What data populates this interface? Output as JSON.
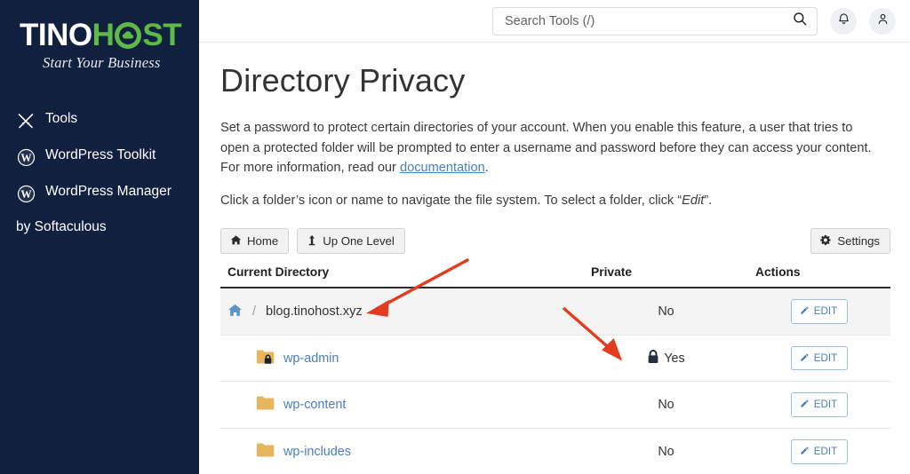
{
  "brand": {
    "logo_tino": "TINO",
    "logo_h": "H",
    "logo_s": "S",
    "logo_t": "T",
    "tagline": "Start Your Business",
    "accent_green": "#5bbb46",
    "sidebar_bg": "#122040"
  },
  "sidebar": {
    "items": [
      {
        "label": "Tools",
        "icon": "tools-icon"
      },
      {
        "label": "WordPress Toolkit",
        "icon": "wordpress-icon"
      },
      {
        "label": "WordPress Manager",
        "label2": "by Softaculous",
        "icon": "wordpress-icon"
      }
    ]
  },
  "topbar": {
    "search_placeholder": "Search Tools (/)",
    "search_value": "",
    "search_icon": "search-icon",
    "bell_icon": "bell-icon",
    "account_icon": "user-icon"
  },
  "page": {
    "title": "Directory Privacy",
    "desc_part1": "Set a password to protect certain directories of your account. When you enable this feature, a user that tries to open a protected folder will be prompted to enter a username and password before they can access your content. For more information, read our ",
    "desc_link": "documentation",
    "desc_part2": ".",
    "desc2_part1": "Click a folder’s icon or name to navigate the file system. To select a folder, click “",
    "desc2_em": "Edit",
    "desc2_part2": "”."
  },
  "toolbar": {
    "home_label": "Home",
    "up_one_level_label": "Up One Level",
    "settings_label": "Settings"
  },
  "table": {
    "headers": {
      "directory": "Current Directory",
      "private": "Private",
      "actions": "Actions"
    },
    "current_directory": {
      "separator": "/",
      "name": "blog.tinohost.xyz",
      "private": "No",
      "action_label": "EDIT",
      "locked": false
    },
    "rows": [
      {
        "name": "wp-admin",
        "private": "Yes",
        "locked": true,
        "action_label": "EDIT"
      },
      {
        "name": "wp-content",
        "private": "No",
        "locked": false,
        "action_label": "EDIT"
      },
      {
        "name": "wp-includes",
        "private": "No",
        "locked": false,
        "action_label": "EDIT"
      }
    ]
  },
  "annotations": {
    "arrow_color": "#e03d20",
    "arrow1_target": "blog.tinohost.xyz directory name",
    "arrow2_target": "Yes private lock indicator"
  }
}
